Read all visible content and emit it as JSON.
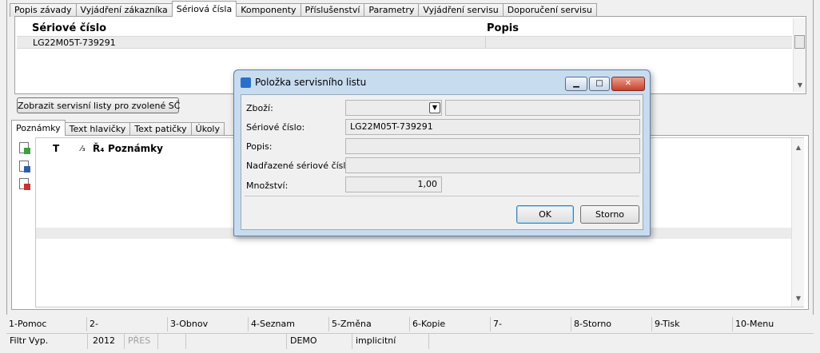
{
  "top_tabs": [
    "Popis závady",
    "Vyjádření zákazníka",
    "Sériová čísla",
    "Komponenty",
    "Příslušenství",
    "Parametry",
    "Vyjádření servisu",
    "Doporučení servisu"
  ],
  "serial_grid": {
    "col_serial": "Sériové číslo",
    "col_desc": "Popis",
    "rows": [
      {
        "serial": "LG22M05T-739291",
        "desc": ""
      }
    ]
  },
  "show_button_label": "Zobrazit servisní listy pro zvolené SČ",
  "lower_tabs": [
    "Poznámky",
    "Text hlavičky",
    "Text patičky",
    "Úkoly"
  ],
  "notes_grid": {
    "col_t": "T",
    "col_order": "⁄₃",
    "col_r": "Ř₄",
    "col_notes": "Poznámky"
  },
  "dialog": {
    "title": "Položka servisního listu",
    "labels": {
      "zbozi": "Zboží:",
      "serial": "Sériové číslo:",
      "popis": "Popis:",
      "parent_serial": "Nadřazené sériové číslo:",
      "mnozstvi": "Množství:"
    },
    "values": {
      "zbozi": "",
      "zbozi_name": "",
      "serial": "LG22M05T-739291",
      "popis": "",
      "parent_serial": "",
      "mnozstvi": "1,00"
    },
    "ok_label": "OK",
    "cancel_label": "Storno"
  },
  "fkeys": [
    "1-Pomoc",
    "2-",
    "3-Obnov",
    "4-Seznam",
    "5-Změna",
    "6-Kopie",
    "7-",
    "8-Storno",
    "9-Tisk",
    "10-Menu"
  ],
  "status": {
    "filter": "Filtr Vyp.",
    "year": "2012",
    "mode": "PŘES",
    "db": "DEMO",
    "setting": "implicitní"
  }
}
